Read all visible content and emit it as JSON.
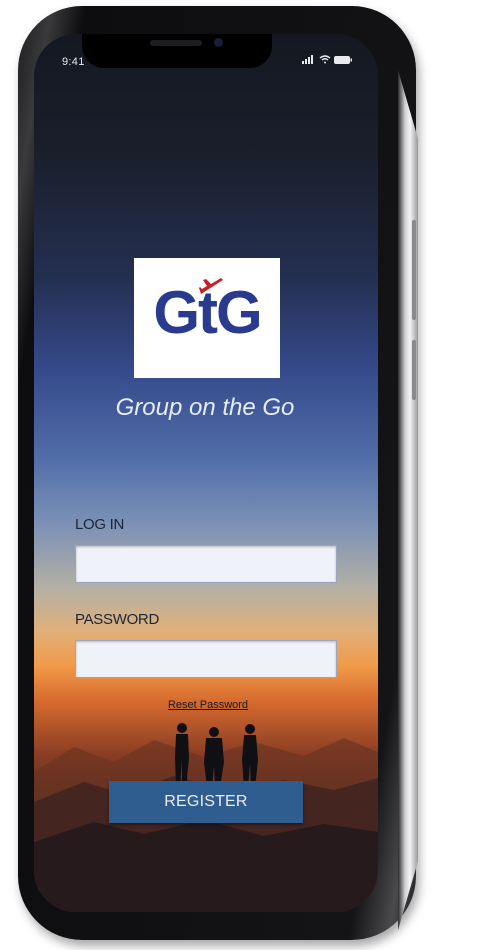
{
  "status_bar": {
    "time": "9:41",
    "icons": [
      "signal-icon",
      "wifi-icon",
      "battery-icon"
    ]
  },
  "app": {
    "logo_text": "GtG",
    "logo_colors": {
      "text": "#2a3b8f",
      "plane": "#c8202a"
    },
    "tagline": "Group on the Go"
  },
  "form": {
    "login_label": "LOG IN",
    "login_value": "",
    "password_label": "PASSWORD",
    "password_value": "",
    "reset_link": "Reset Password",
    "register_label": "REGISTER"
  },
  "colors": {
    "register_button": "#2f5d8f",
    "field_background": "#f0f2fa"
  }
}
